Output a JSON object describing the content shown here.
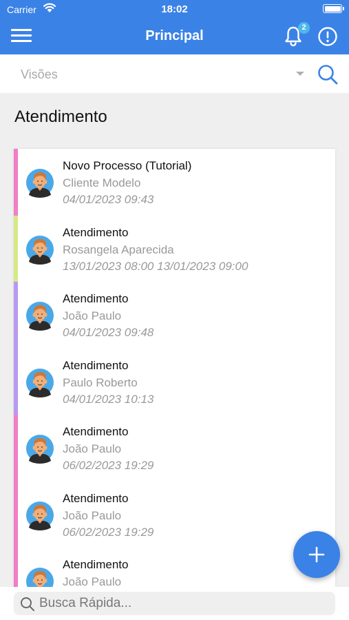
{
  "status_bar": {
    "carrier": "Carrier",
    "time": "18:02"
  },
  "header": {
    "title": "Principal",
    "notification_count": "2"
  },
  "filter": {
    "placeholder": "Visões"
  },
  "section": {
    "title": "Atendimento"
  },
  "items": [
    {
      "title": "Novo Processo (Tutorial)",
      "client": "Cliente Modelo",
      "date": "04/01/2023 09:43",
      "color": "#f17ec6"
    },
    {
      "title": "Atendimento",
      "client": "Rosangela Aparecida",
      "date": "13/01/2023 08:00  13/01/2023 09:00",
      "color": "#d6e984"
    },
    {
      "title": "Atendimento",
      "client": "João Paulo",
      "date": "04/01/2023 09:48",
      "color": "#b79af0"
    },
    {
      "title": "Atendimento",
      "client": "Paulo Roberto",
      "date": "04/01/2023 10:13",
      "color": "#b79af0"
    },
    {
      "title": "Atendimento",
      "client": "João Paulo",
      "date": "06/02/2023 19:29",
      "color": "#f17ec6"
    },
    {
      "title": "Atendimento",
      "client": "João Paulo",
      "date": "06/02/2023 19:29",
      "color": "#f17ec6"
    },
    {
      "title": "Atendimento",
      "client": "João Paulo",
      "date": "",
      "color": "#f17ec6"
    }
  ],
  "quick_search": {
    "placeholder": "Busca Rápida..."
  },
  "colors": {
    "primary": "#3b82e6",
    "badge": "#4fb6ee"
  },
  "icons": [
    "menu-icon",
    "bell-icon",
    "info-icon",
    "search-icon",
    "plus-icon",
    "avatar"
  ]
}
